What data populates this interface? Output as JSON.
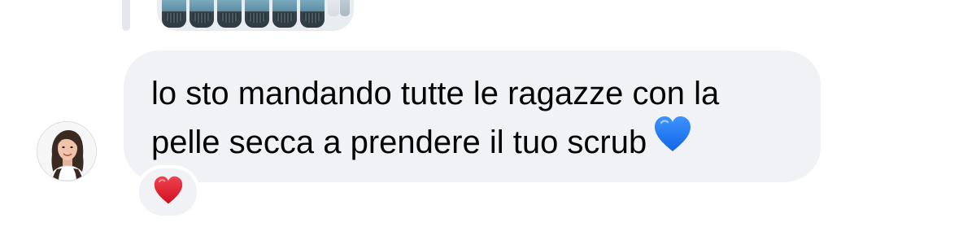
{
  "previous_message": {
    "attachment_icon": "product-photo-icon"
  },
  "message": {
    "sender_avatar_icon": "avatar-icon",
    "lines": [
      "lo sto mandando tutte le ragazze con la",
      "pelle secca a prendere il tuo scrub"
    ],
    "emoji_icon": "blue-heart-icon",
    "bubble_color": "#f0f2f5",
    "text_color": "#050505"
  },
  "reaction": {
    "icon": "red-heart-icon",
    "color": "#e0202d"
  },
  "blue_heart_color": "#1e7bff"
}
